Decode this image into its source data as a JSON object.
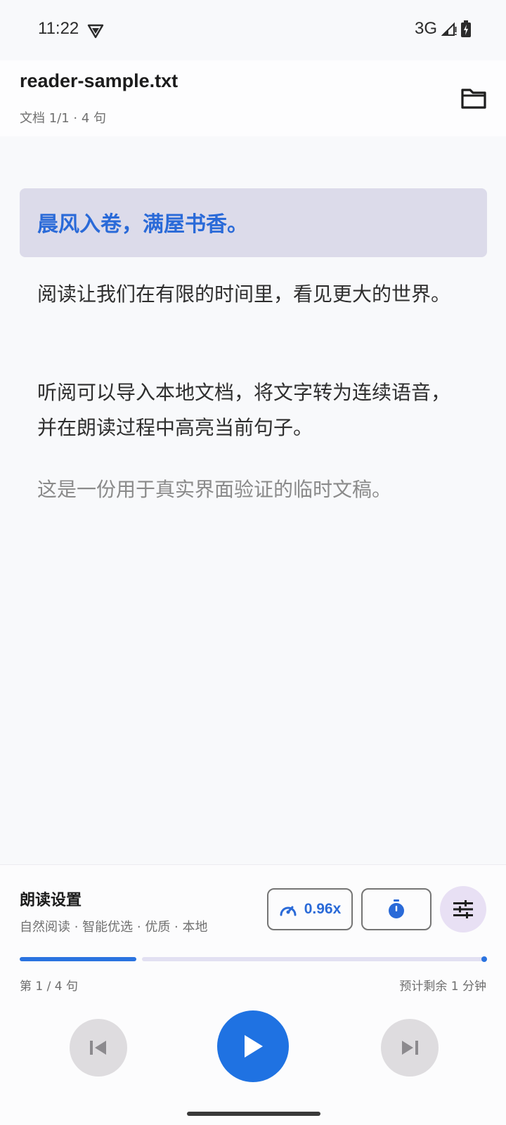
{
  "status_bar": {
    "time": "11:22",
    "network": "3G",
    "icons": [
      "vpn-shield-icon",
      "signal-icon",
      "battery-icon"
    ]
  },
  "app_bar": {
    "title": "reader-sample.txt",
    "meta": "文档 1/1 · 4 句",
    "action_icon": "folder-icon"
  },
  "document": {
    "sentences": [
      {
        "text": "晨风入卷，满屋书香。",
        "state": "current"
      },
      {
        "text": "阅读让我们在有限的时间里，看见更大的世界。",
        "state": "upcoming"
      },
      {
        "text": "听阅可以导入本地文档，将文字转为连续语音，并在朗读过程中高亮当前句子。",
        "state": "upcoming"
      },
      {
        "text": "这是一份用于真实界面验证的临时文稿。",
        "state": "dimmed"
      }
    ]
  },
  "player": {
    "settings_title": "朗读设置",
    "settings_summary": "自然阅读 · 智能优选 · 优质 · 本地",
    "speed_label": "0.96x",
    "progress_fraction": 0.25,
    "position_label": "第 1 / 4 句",
    "remaining_label": "预计剩余 1 分钟"
  },
  "colors": {
    "accent": "#1f72e2",
    "highlight_bg": "#dcdbea",
    "tune_bg": "#e8e0f4"
  }
}
